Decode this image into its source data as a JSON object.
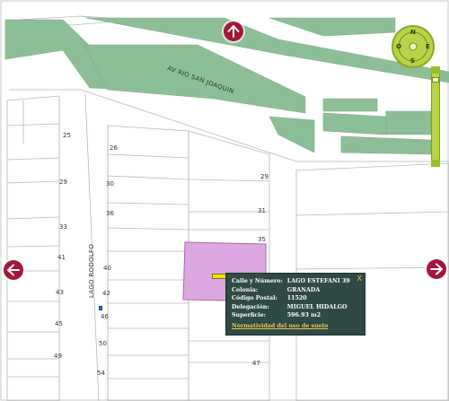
{
  "map": {
    "streets": {
      "avenue": "AV RIO SAN JOAQUIN",
      "vertical": "LAGO RODOLFO"
    },
    "lot_numbers": {
      "left_column": [
        "25",
        "29",
        "33",
        "41",
        "43",
        "45",
        "49"
      ],
      "middle_column": [
        "26",
        "30",
        "36",
        "40",
        "42",
        "46",
        "50",
        "54"
      ],
      "right_column": [
        "29",
        "31",
        "35",
        "47"
      ]
    },
    "colors": {
      "park_green": "#8cbf96",
      "selected_lot": "#dba8df",
      "selected_outline": "#b561b8",
      "nav_button": "#a3163c",
      "popup_bg": "#2e4a44",
      "popup_link": "#e8c54a"
    }
  },
  "navigation": {
    "pan_up_icon": "arrow-up-icon",
    "pan_left_icon": "arrow-left-icon",
    "pan_right_icon": "arrow-right-icon",
    "compass_letters": [
      "N",
      "S",
      "E",
      "O"
    ]
  },
  "popup": {
    "close_label": "X",
    "rows": [
      {
        "label": "Calle y Número:",
        "value": "LAGO ESTEFANI 39"
      },
      {
        "label": "Colonia:",
        "value": "GRANADA"
      },
      {
        "label": "Código Postal:",
        "value": "11520"
      },
      {
        "label": "Delegación:",
        "value": "MIGUEL HIDALGO"
      },
      {
        "label": "Superficie:",
        "value": "596.93 m2"
      }
    ],
    "link_label": "Normatividad del uso de suelo"
  }
}
